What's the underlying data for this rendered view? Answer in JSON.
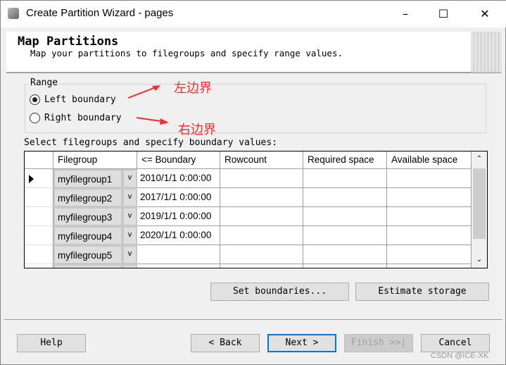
{
  "window": {
    "title": "Create Partition Wizard - pages",
    "minimize": "–",
    "maximize": "☐",
    "close": "✕"
  },
  "header": {
    "title": "Map Partitions",
    "subtitle": "Map your partitions to filegroups and specify range values."
  },
  "range": {
    "label": "Range",
    "options": [
      {
        "label": "Left boundary",
        "selected": true
      },
      {
        "label": "Right boundary",
        "selected": false
      }
    ]
  },
  "annotations": {
    "left": "左边界",
    "right": "右边界",
    "color": "#ff2a2a"
  },
  "grid": {
    "caption": "Select filegroups and specify boundary values:",
    "columns": [
      "Filegroup",
      "<= Boundary",
      "Rowcount",
      "Required space",
      "Available space"
    ],
    "rows": [
      {
        "filegroup": "myfilegroup1",
        "boundary": "2010/1/1 0:00:00",
        "current": true
      },
      {
        "filegroup": "myfilegroup2",
        "boundary": "2017/1/1 0:00:00"
      },
      {
        "filegroup": "myfilegroup3",
        "boundary": "2019/1/1 0:00:00"
      },
      {
        "filegroup": "myfilegroup4",
        "boundary": "2020/1/1 0:00:00"
      },
      {
        "filegroup": "myfilegroup5",
        "boundary": ""
      }
    ]
  },
  "buttons": {
    "set_boundaries": "Set boundaries...",
    "estimate": "Estimate storage",
    "help": "Help",
    "back": "< Back",
    "next": "Next >",
    "finish": "Finish >>|",
    "cancel": "Cancel"
  },
  "watermark": "CSDN @ICE-XK"
}
